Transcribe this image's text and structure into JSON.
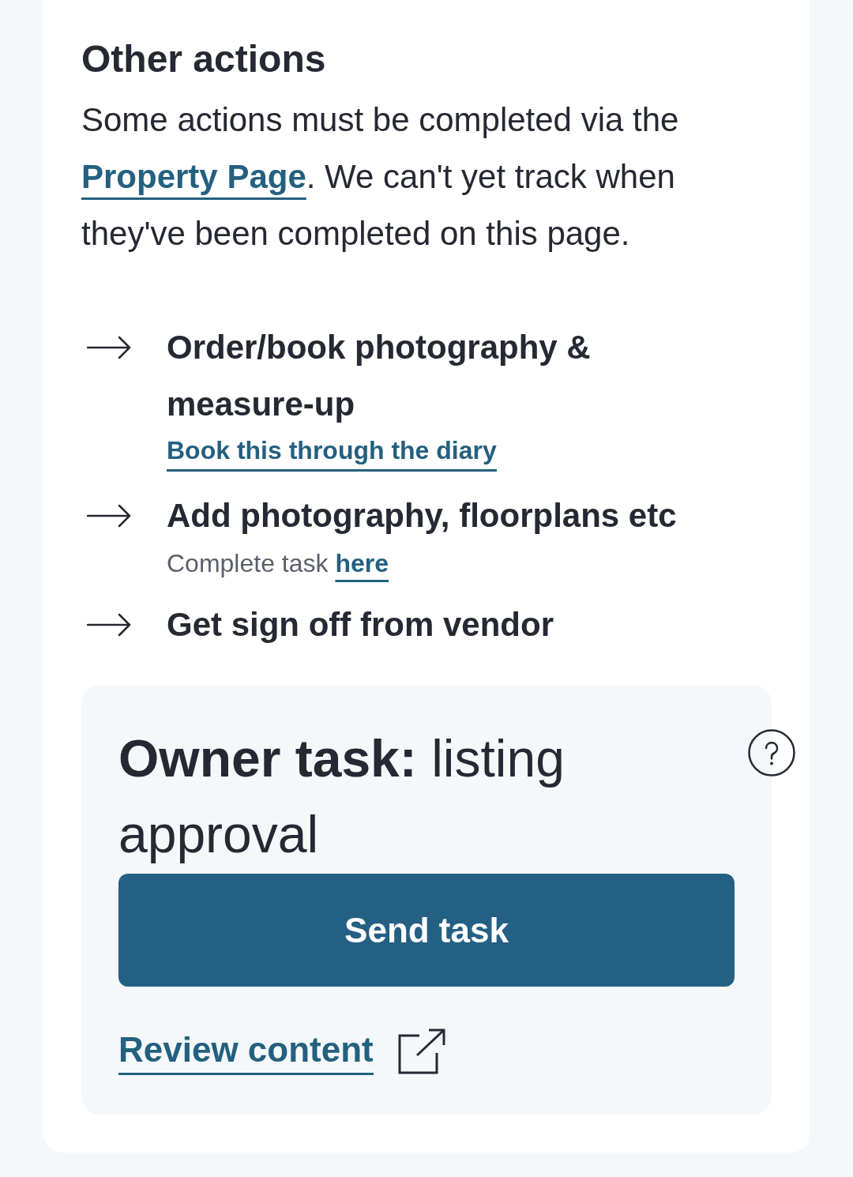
{
  "section": {
    "title": "Other actions",
    "intro": {
      "text_before": "Some actions must be completed via the",
      "link": "Property Page",
      "text_after": ". We can't yet track when they've been completed on this page."
    }
  },
  "actions": [
    {
      "title": "Order/book photography & measure-up",
      "link": "Book this through the diary"
    },
    {
      "title": "Add photography, floorplans etc",
      "note": "Complete task",
      "note_link": "here"
    },
    {
      "title": "Get sign off from vendor"
    }
  ],
  "owner_task": {
    "title": "**Owner task:** listing approval",
    "button": "Send task",
    "review_link": "Review content"
  }
}
